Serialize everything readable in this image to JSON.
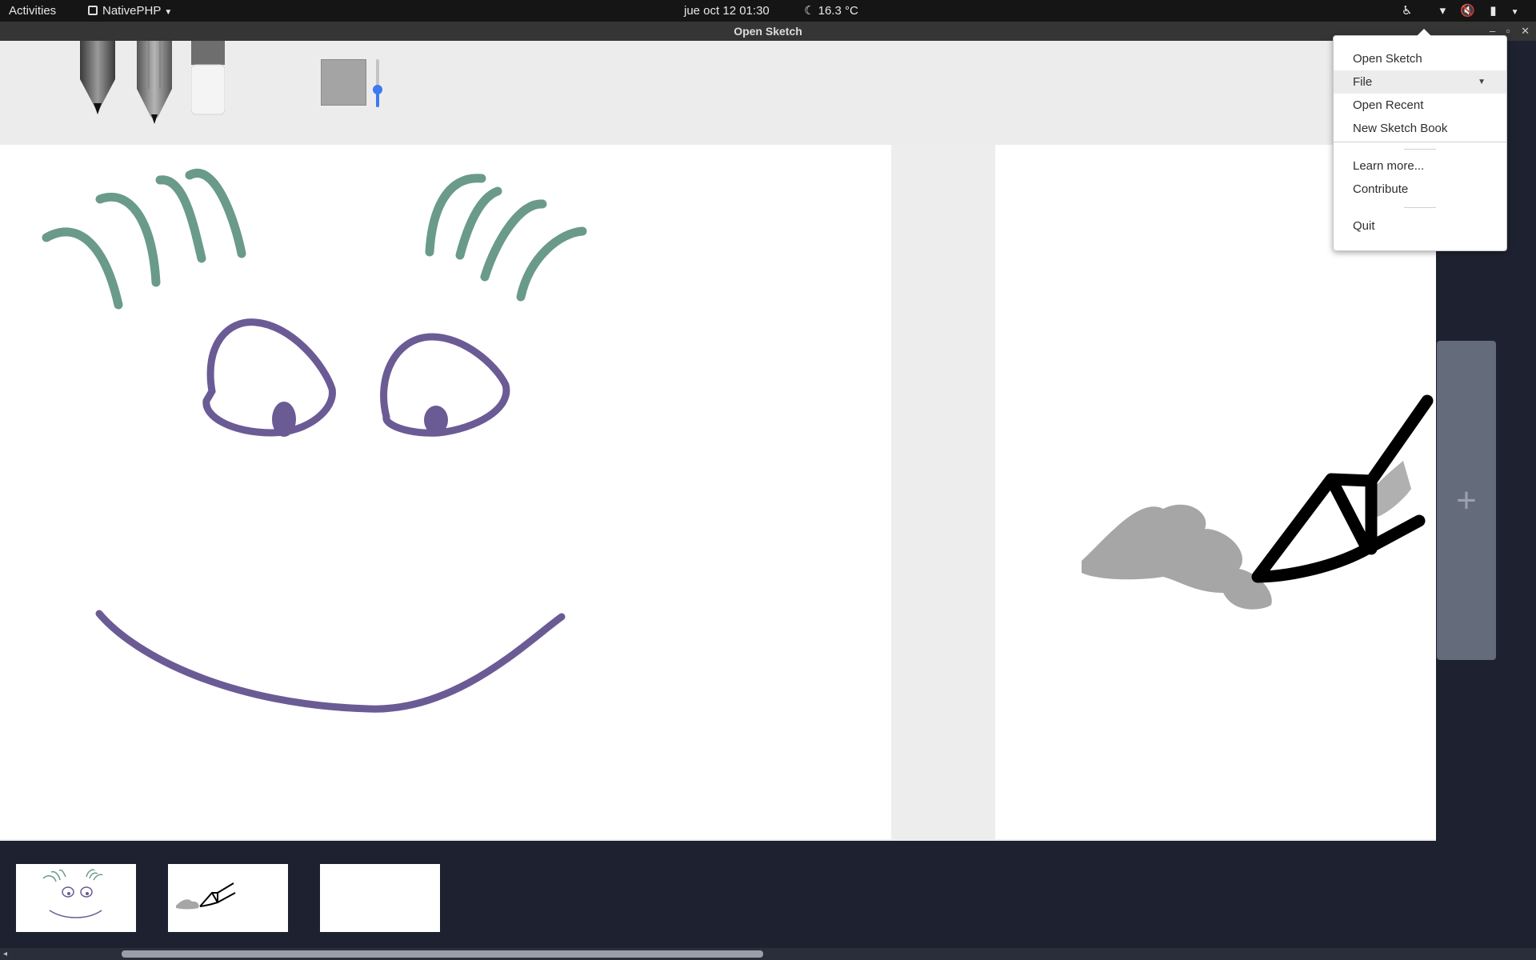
{
  "topbar": {
    "activities": "Activities",
    "app_name": "NativePHP",
    "datetime": "jue oct 12  01:30",
    "weather": "16.3 °C",
    "tray_icons": [
      "accessibility-icon",
      "wifi-icon",
      "volume-muted-icon",
      "battery-icon",
      "system-menu-arrow-icon"
    ]
  },
  "window": {
    "title": "Open Sketch",
    "controls": [
      "minimize-icon",
      "maximize-icon",
      "close-icon"
    ]
  },
  "toolbar": {
    "tools": [
      "pen",
      "pencil",
      "eraser"
    ],
    "current_color": "#a4a4a4",
    "slider_accent": "#3c7bf0",
    "brush_size_level": 0.4
  },
  "menu": {
    "items": [
      {
        "label": "Open Sketch"
      },
      {
        "label": "File",
        "has_submenu": true,
        "active": true
      },
      {
        "label": "Open Recent"
      },
      {
        "label": "New Sketch Book"
      },
      {
        "label": "Learn more..."
      },
      {
        "label": "Contribute"
      },
      {
        "label": "Quit"
      }
    ]
  },
  "drawing_colors": {
    "hair": "#6a9a8a",
    "face": "#6b5b95",
    "ink": "#000000",
    "smudge": "#a6a6a6"
  },
  "add_page_symbol": "+",
  "pages_strip": {
    "page_count": 3
  }
}
